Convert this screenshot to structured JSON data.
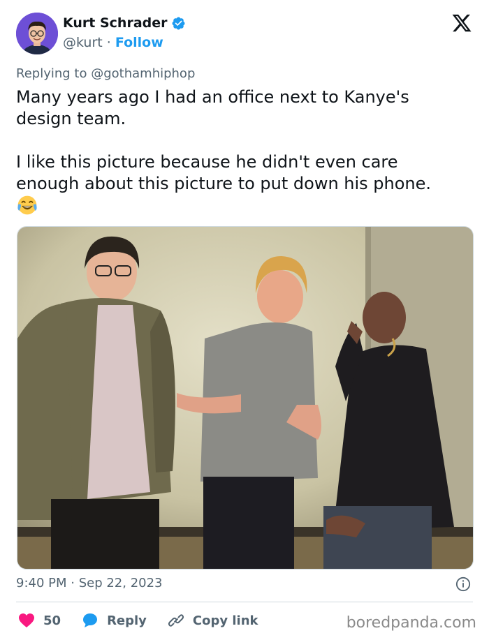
{
  "author": {
    "display_name": "Kurt Schrader",
    "handle": "@kurt",
    "separator": "·",
    "follow_label": "Follow",
    "verified": true
  },
  "replying": {
    "prefix": "Replying to",
    "mention": "@gothamhiphop"
  },
  "tweet": {
    "text": "Many years ago I had an office next to Kanye's\ndesign team.\n\nI like this picture because he didn't even care\nenough about this picture to put down his phone.",
    "emoji": "face-with-tears-of-joy"
  },
  "meta": {
    "timestamp": "9:40 PM · Sep 22, 2023"
  },
  "actions": {
    "likes_count": "50",
    "reply_label": "Reply",
    "copy_link_label": "Copy link"
  },
  "watermark": "boredpanda.com",
  "colors": {
    "accent": "#1d9bf0",
    "heart": "#f91880",
    "muted": "#536471",
    "text": "#0f1419",
    "divider": "#cfd9de"
  },
  "icons": [
    "verified-badge-icon",
    "x-logo-icon",
    "info-icon",
    "heart-icon",
    "reply-bubble-icon",
    "link-icon"
  ]
}
